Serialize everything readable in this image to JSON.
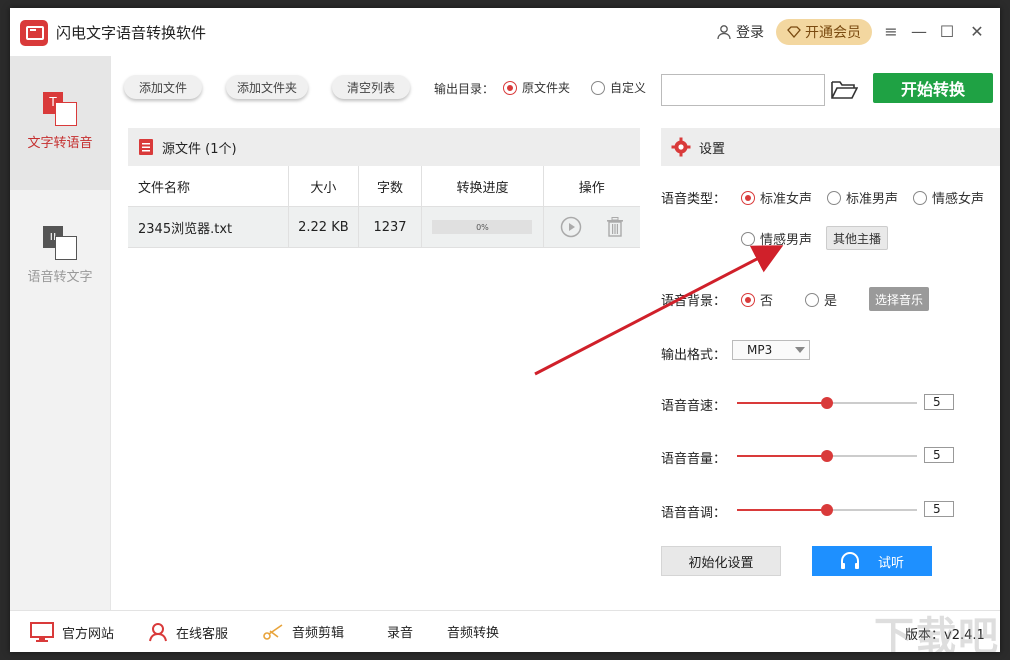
{
  "app": {
    "title": "闪电文字语音转换软件",
    "login": "登录",
    "vip": "开通会员"
  },
  "sidebar": {
    "items": [
      {
        "label": "文字转语音"
      },
      {
        "label": "语音转文字"
      }
    ]
  },
  "toolbar": {
    "add_file": "添加文件",
    "add_folder": "添加文件夹",
    "clear_list": "清空列表",
    "output_dir_label": "输出目录：",
    "option_source": "原文件夹",
    "option_custom": "自定义",
    "path_value": "",
    "start": "开始转换"
  },
  "file_list": {
    "header": "源文件 (1个)",
    "columns": [
      "文件名称",
      "大小",
      "字数",
      "转换进度",
      "操作"
    ],
    "rows": [
      {
        "name": "2345浏览器.txt",
        "size": "2.22 KB",
        "chars": "1237",
        "progress_text": "0%",
        "progress": 0
      }
    ]
  },
  "settings": {
    "title": "设置",
    "voice_type_label": "语音类型：",
    "voice_options": [
      "标准女声",
      "标准男声",
      "情感女声",
      "情感男声"
    ],
    "voice_selected": "标准女声",
    "other_anchor": "其他主播",
    "bg_label": "语音背景：",
    "bg_no": "否",
    "bg_yes": "是",
    "bg_selected": "否",
    "choose_music": "选择音乐",
    "format_label": "输出格式：",
    "format_value": "MP3",
    "speed_label": "语音音速：",
    "speed_value": "5",
    "volume_label": "语音音量：",
    "volume_value": "5",
    "pitch_label": "语音音调：",
    "pitch_value": "5",
    "slider_fraction": 0.5,
    "reset": "初始化设置",
    "listen": "试听"
  },
  "footer": {
    "website": "官方网站",
    "support": "在线客服",
    "audio_edit": "音频剪辑",
    "record": "录音",
    "audio_convert": "音频转换",
    "version": "版本：v2.4.1"
  },
  "watermark": "下载吧",
  "colors": {
    "accent_red": "#d93a3a",
    "start_green": "#1fa244",
    "listen_blue": "#1e90ff"
  }
}
